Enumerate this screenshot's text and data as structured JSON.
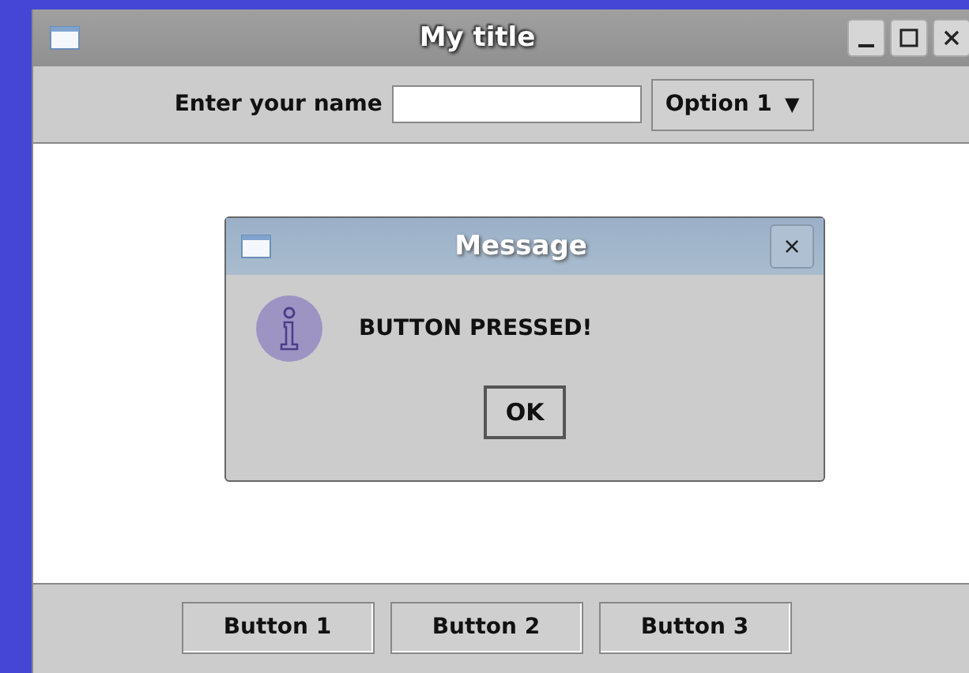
{
  "window": {
    "title": "My title"
  },
  "toolbar": {
    "name_label": "Enter your name",
    "combo_value": "Option 1",
    "combo_arrow": "▼"
  },
  "dialog": {
    "title": "Message",
    "close": "×",
    "message": "BUTTON PRESSED!",
    "button": "OK"
  },
  "buttons": [
    "Button 1",
    "Button 2",
    "Button 3"
  ]
}
